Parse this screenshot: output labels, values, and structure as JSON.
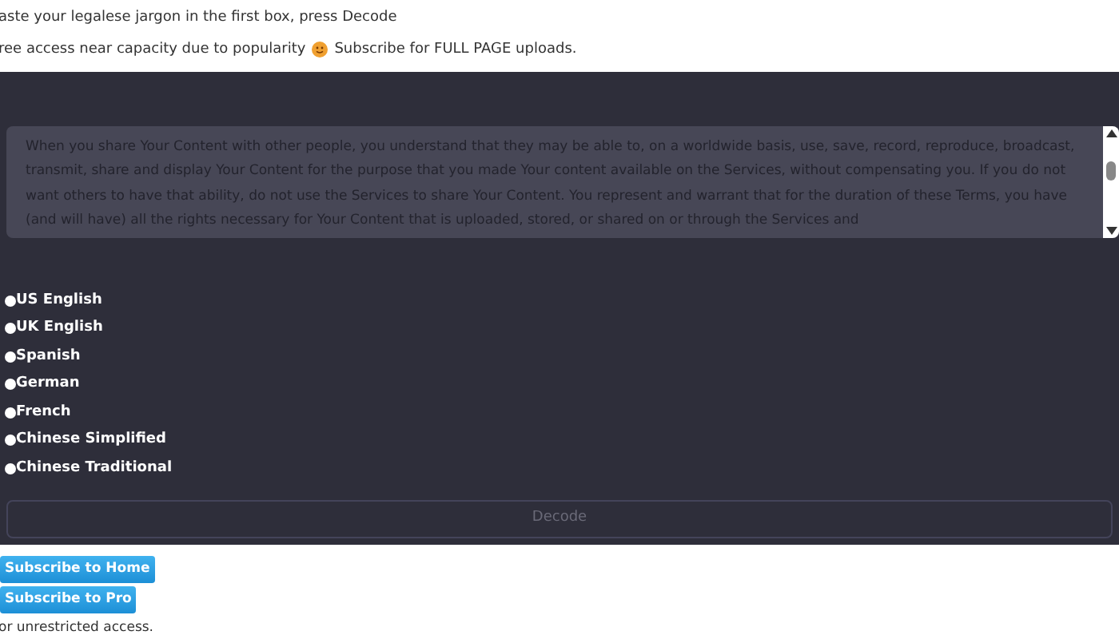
{
  "instructions": "aste your legalese jargon in the first box, press Decode",
  "notice": {
    "before": "ree access near capacity due to popularity",
    "after": "Subscribe for FULL PAGE uploads."
  },
  "input_box": {
    "value": "When you share Your Content with other people, you understand that they may be able to, on a worldwide basis, use, save, record, reproduce, broadcast, transmit, share and display Your Content for the purpose that you made Your content available on the Services, without compensating you. If you do not want others to have that ability, do not use the Services to share Your Content. You represent and warrant that for the duration of these Terms, you have (and will have) all the rights necessary for Your Content that is uploaded, stored, or shared on or through the Services and"
  },
  "languages": [
    {
      "label": "US English",
      "selected": false
    },
    {
      "label": "UK English",
      "selected": false
    },
    {
      "label": "Spanish",
      "selected": false
    },
    {
      "label": "German",
      "selected": false
    },
    {
      "label": "French",
      "selected": false
    },
    {
      "label": "Chinese Simplified",
      "selected": false
    },
    {
      "label": "Chinese Traditional",
      "selected": false
    }
  ],
  "decode_button": {
    "label": "Decode",
    "disabled": true
  },
  "subscribe_buttons": [
    "Subscribe to Home",
    "Subscribe to Pro"
  ],
  "footer": "or unrestricted access."
}
